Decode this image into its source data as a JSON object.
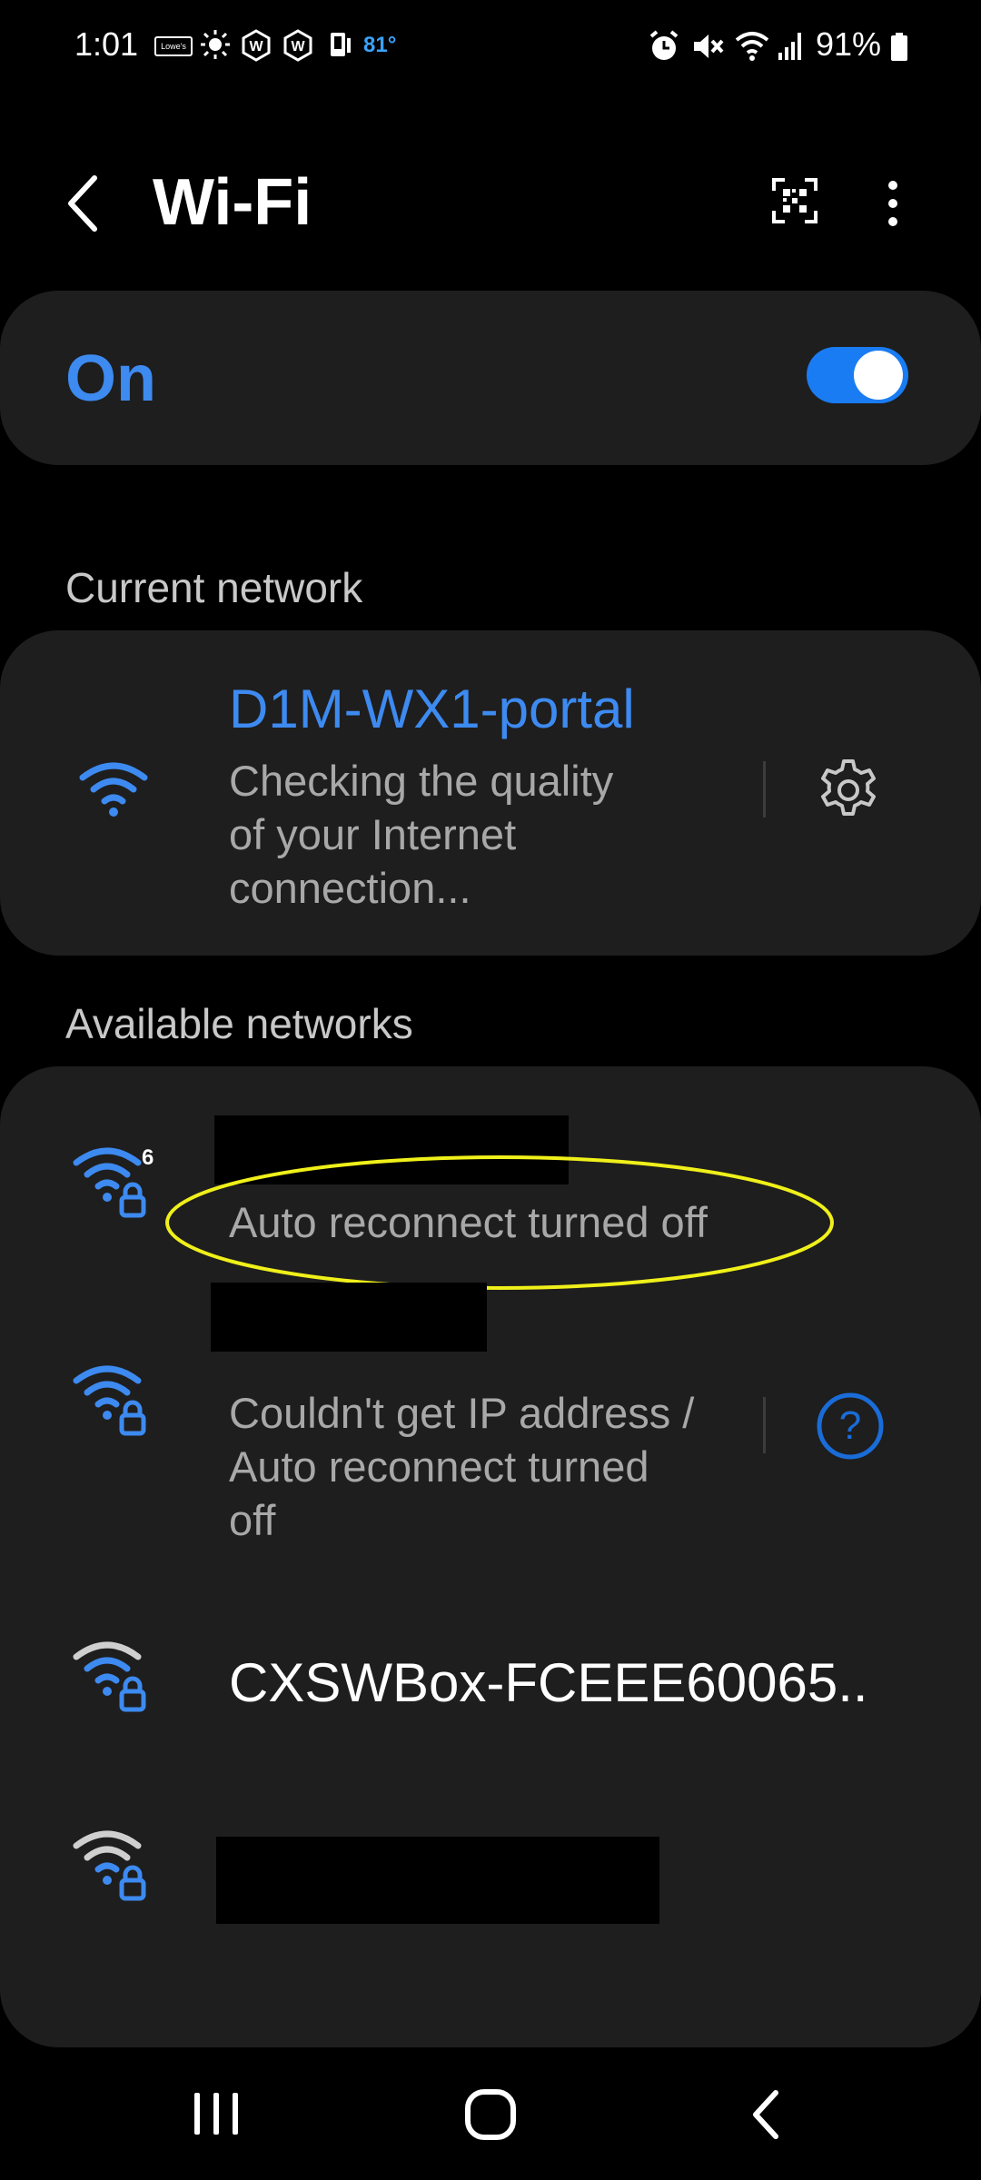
{
  "status_bar": {
    "time": "1:01",
    "store_badge": "Lowe's",
    "temperature": "81°",
    "battery": "91%",
    "icons": [
      "store-icon",
      "sun-icon",
      "w-app-icon",
      "w-app-icon",
      "phone-icon",
      "alarm-icon",
      "mute-icon",
      "wifi-icon",
      "signal-icon",
      "battery-icon"
    ]
  },
  "header": {
    "title": "Wi-Fi"
  },
  "toggle": {
    "label": "On",
    "state": "on"
  },
  "current_network": {
    "section_label": "Current network",
    "name": "D1M-WX1-portal",
    "status_lines": [
      "Checking the quality",
      "of your Internet",
      "connection..."
    ]
  },
  "available_networks": {
    "section_label": "Available networks",
    "items": [
      {
        "name": "",
        "status": "Auto reconnect turned off",
        "icon": "wifi6-lock-icon"
      },
      {
        "name": "",
        "status_lines": [
          "Couldn't get IP address /",
          "Auto reconnect turned",
          "off"
        ],
        "icon": "wifi-lock-icon"
      },
      {
        "name": "CXSWBox-FCEEE60065..",
        "icon": "wifi-lock-icon"
      },
      {
        "name": "",
        "icon": "wifi-lock-icon"
      }
    ]
  },
  "colors": {
    "accent": "#3d8af0",
    "card": "#1e1e1e",
    "toggle_track": "#1a7cf2",
    "highlight": "#f0f01a",
    "help_blue": "#1a6cd8"
  }
}
